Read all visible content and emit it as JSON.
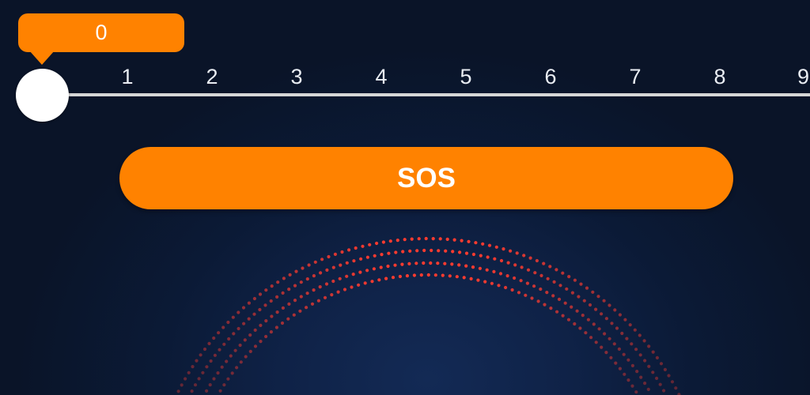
{
  "slider": {
    "value": "0",
    "ticks": [
      "1",
      "2",
      "3",
      "4",
      "5",
      "6",
      "7",
      "8",
      "9"
    ]
  },
  "sos_button": {
    "label": "SOS"
  },
  "colors": {
    "accent": "#ff8200",
    "track": "#d6d6d6",
    "background": "#0b1a36",
    "pulse_dots": "#ff3b2f"
  }
}
